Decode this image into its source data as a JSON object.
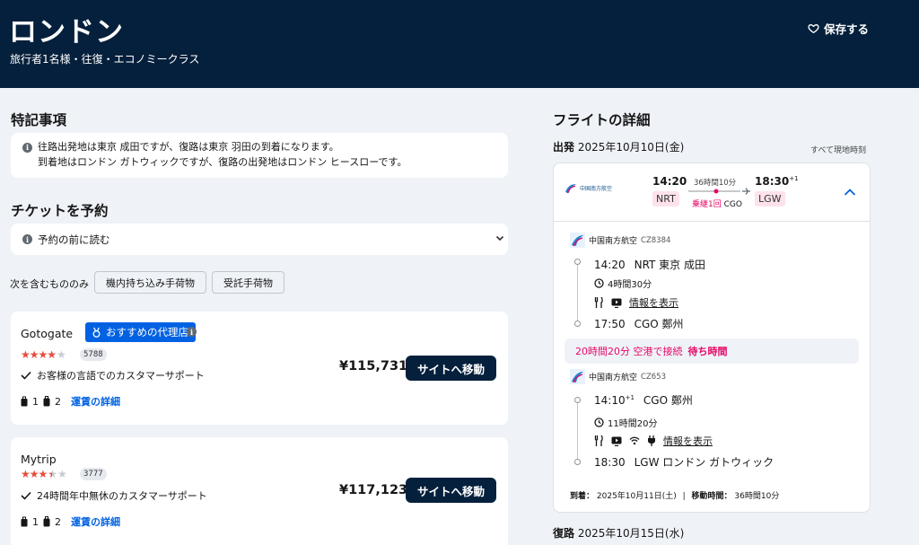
{
  "header": {
    "title": "ロンドン",
    "subtitle": "旅行者1名様・往復・エコノミークラス",
    "save_label": "保存する"
  },
  "notices": {
    "title": "特記事項",
    "line1": "往路出発地は東京 成田ですが、復路は東京 羽田の到着になります。",
    "line2": "到着地はロンドン ガトウィックですが、復路の出発地はロンドン ヒースローです。"
  },
  "booking": {
    "title": "チケットを予約",
    "read_first": "予約の前に読む",
    "filter_label": "次を含むもののみ",
    "chips": [
      "機内持ち込み手荷物",
      "受託手荷物"
    ],
    "agents": [
      {
        "name": "Gotogate",
        "badge": "おすすめの代理店",
        "rating": 4,
        "reviews": "5788",
        "support": "お客様の言語でのカスタマーサポート",
        "carry_on": "1",
        "checked": "2",
        "fare_link": "運賃の詳細",
        "price": "¥115,731",
        "button": "サイトへ移動"
      },
      {
        "name": "Mytrip",
        "rating": 3.5,
        "reviews": "3777",
        "support": "24時間年中無休のカスタマーサポート",
        "carry_on": "1",
        "checked": "2",
        "fare_link": "運賃の詳細",
        "price": "¥117,123",
        "button": "サイトへ移動"
      }
    ]
  },
  "flight": {
    "title": "フライトの詳細",
    "outbound_label": "出発",
    "outbound_date": "2025年10月10日(金)",
    "local_time": "すべて現地時刻",
    "summary": {
      "dep_time": "14:20",
      "dep_code": "NRT",
      "duration": "36時間10分",
      "stops": "乗継1回",
      "via": "CGO",
      "arr_time": "18:30",
      "arr_sup": "+1",
      "arr_code": "LGW"
    },
    "segments": [
      {
        "airline": "中国南方航空",
        "code": "CZ8384",
        "dep_time": "14:20",
        "dep_airport": "NRT 東京 成田",
        "duration": "4時間30分",
        "info_link": "情報を表示",
        "arr_time": "17:50",
        "arr_airport": "CGO 鄭州"
      },
      {
        "airline": "中国南方航空",
        "code": "CZ653",
        "dep_time": "14:10",
        "dep_sup": "+1",
        "dep_airport": "CGO 鄭州",
        "duration": "11時間20分",
        "info_link": "情報を表示",
        "arr_time": "18:30",
        "arr_airport": "LGW ロンドン ガトウィック"
      }
    ],
    "layover": {
      "text": "20時間20分 空港で接続",
      "wait": "待ち時間"
    },
    "arrival_label": "到着：",
    "arrival_date": "2025年10月11日(土)",
    "travel_time_label": "移動時間：",
    "travel_time": "36時間10分",
    "return_label": "復路",
    "return_date": "2025年10月15日(水)"
  },
  "colors": {
    "navy": "#05203c",
    "brand_blue": "#0062e3",
    "accent_pink": "#e70866",
    "star_red": "#e74c3c"
  }
}
